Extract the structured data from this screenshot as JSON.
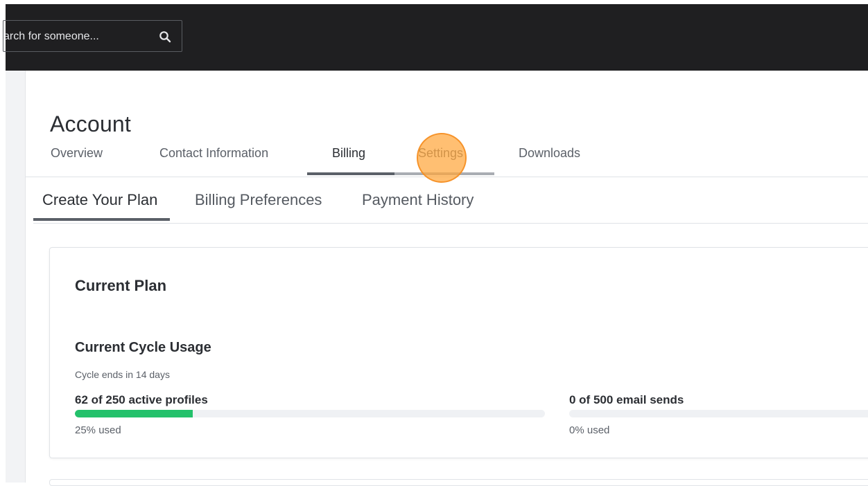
{
  "header": {
    "search": {
      "placeholder": "arch for someone..."
    }
  },
  "page": {
    "title": "Account"
  },
  "main_tabs": [
    {
      "label": "Overview",
      "active": false
    },
    {
      "label": "Contact Information",
      "active": false
    },
    {
      "label": "Billing",
      "active": true
    },
    {
      "label": "Settings",
      "active": false
    },
    {
      "label": "Downloads",
      "active": false
    }
  ],
  "sub_tabs": [
    {
      "label": "Create Your Plan",
      "active": true
    },
    {
      "label": "Billing Preferences",
      "active": false
    },
    {
      "label": "Payment History",
      "active": false
    }
  ],
  "plan_card": {
    "title": "Current Plan",
    "usage_title": "Current Cycle Usage",
    "cycle_ends": "Cycle ends in 14 days",
    "meters": [
      {
        "label": "62 of 250 active profiles",
        "percent_text": "25% used",
        "fill_fraction": 0.25
      },
      {
        "label": "0 of 500 email sends",
        "percent_text": "0% used",
        "fill_fraction": 0.0
      }
    ]
  },
  "colors": {
    "topbar_bg": "#1f1f21",
    "meter_fill": "#24c16b",
    "tab_underline_active": "#5b6068",
    "tab_underline_hover": "#a9adb3",
    "click_indicator": "#ffa63c"
  },
  "icons": {
    "search": "search-icon"
  }
}
